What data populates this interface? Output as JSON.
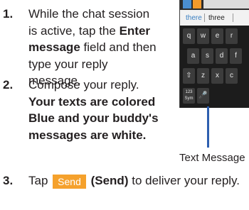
{
  "steps": [
    {
      "number": "1.",
      "lines": [
        "While the chat session",
        "is active, tap the ",
        "message",
        "type your reply",
        "message."
      ],
      "bold_phrase_a": "Enter",
      "line2_tail": "field and then"
    },
    {
      "number": "2.",
      "line1": "Compose your reply.",
      "bold_lines": [
        "Your texts are colored",
        "Blue and your buddy's",
        "messages are white."
      ]
    },
    {
      "number": "3.",
      "prefix": "Tap",
      "button_label": "Send",
      "bold_label": "(Send)",
      "suffix": "to deliver your reply."
    }
  ],
  "figure": {
    "suggestions": [
      "there",
      "three"
    ],
    "keys_row1": [
      "q",
      "w",
      "e",
      "r"
    ],
    "keys_row2": [
      "a",
      "s",
      "d",
      "f"
    ],
    "keys_row3": [
      "⇧",
      "z",
      "x",
      "c"
    ],
    "keys_row4": [
      "123 Sym",
      "🎤"
    ],
    "callout_label": "Text Message"
  }
}
